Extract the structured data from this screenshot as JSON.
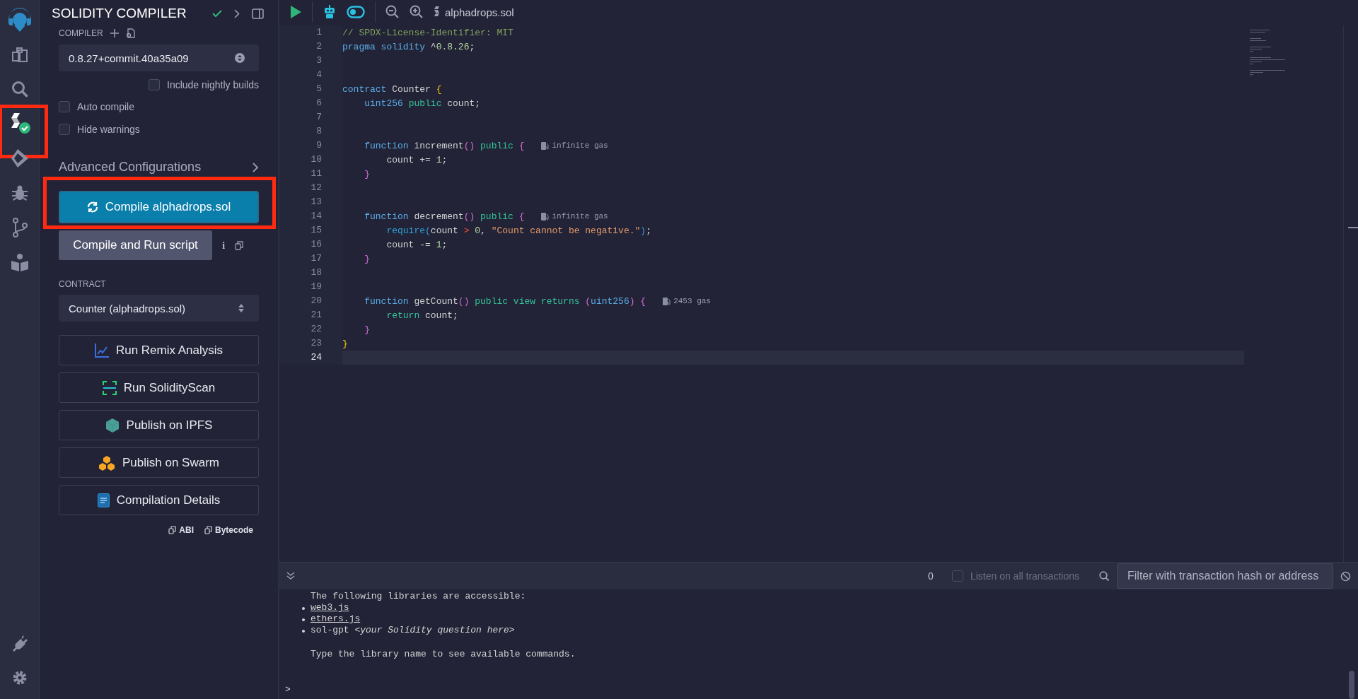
{
  "icon_bar": {
    "top": [
      {
        "kind": "logo",
        "highlighted": false
      },
      {
        "kind": "files",
        "highlighted": false
      },
      {
        "kind": "search",
        "highlighted": false
      },
      {
        "kind": "compiler",
        "highlighted": true
      },
      {
        "kind": "deploy",
        "highlighted": false
      },
      {
        "kind": "debugger",
        "highlighted": false
      },
      {
        "kind": "git",
        "highlighted": false
      },
      {
        "kind": "learn",
        "highlighted": false
      }
    ],
    "bottom": [
      {
        "kind": "plugins",
        "highlighted": false
      },
      {
        "kind": "settings",
        "highlighted": false
      }
    ]
  },
  "panel": {
    "title": "SOLIDITY COMPILER",
    "compiler_label": "COMPILER",
    "version": "0.8.27+commit.40a35a09",
    "nightly": {
      "label": "Include nightly builds",
      "checked": false
    },
    "options": [
      {
        "label": "Auto compile",
        "checked": false
      },
      {
        "label": "Hide warnings",
        "checked": false
      }
    ],
    "advanced": "Advanced Configurations",
    "compile_button": {
      "label": "Compile alphadrops.sol",
      "highlighted": true
    },
    "run_script": {
      "label": "Compile and Run script",
      "info": "i"
    },
    "contract_label": "CONTRACT",
    "contract": "Counter (alphadrops.sol)",
    "actions": [
      {
        "kind": "analysis",
        "label": "Run Remix Analysis"
      },
      {
        "kind": "scan",
        "label": "Run SolidityScan"
      },
      {
        "kind": "ipfs",
        "label": "Publish on IPFS"
      },
      {
        "kind": "swarm",
        "label": "Publish on Swarm"
      },
      {
        "kind": "details",
        "label": "Compilation Details"
      }
    ],
    "copy_links": [
      {
        "label": "ABI"
      },
      {
        "label": "Bytecode"
      }
    ]
  },
  "editor": {
    "file_tab": "alphadrops.sol",
    "lines": [
      {
        "number": "1",
        "current": false,
        "tokens": [
          {
            "kind": "comment",
            "s": "// SPDX-License-Identifier: MIT"
          }
        ]
      },
      {
        "number": "2",
        "current": false,
        "tokens": [
          {
            "kind": "keyword",
            "s": "pragma solidity"
          },
          {
            "kind": "plain",
            "s": " ^"
          },
          {
            "kind": "number",
            "s": "0.8.26"
          },
          {
            "kind": "plain",
            "s": ";"
          }
        ]
      },
      {
        "number": "3",
        "current": false
      },
      {
        "number": "4",
        "current": false
      },
      {
        "number": "5",
        "current": false,
        "tokens": [
          {
            "kind": "keyword",
            "s": "contract"
          },
          {
            "kind": "plain",
            "s": " Counter "
          },
          {
            "kind": "brace_outer",
            "s": "{"
          }
        ]
      },
      {
        "number": "6",
        "current": false,
        "tokens": [
          {
            "kind": "keyword",
            "s": "    uint256"
          },
          {
            "kind": "modifier",
            "s": " public"
          },
          {
            "kind": "plain",
            "s": " count;"
          }
        ]
      },
      {
        "number": "7",
        "current": false
      },
      {
        "number": "8",
        "current": false
      },
      {
        "number": "9",
        "current": false,
        "tokens": [
          {
            "kind": "keyword",
            "s": "    function"
          },
          {
            "kind": "plain",
            "s": " increment"
          },
          {
            "kind": "paren",
            "s": "()"
          },
          {
            "kind": "modifier",
            "s": " public"
          },
          {
            "kind": "paren",
            "s": " {"
          }
        ],
        "hint": "infinite gas"
      },
      {
        "number": "10",
        "current": false,
        "tokens": [
          {
            "kind": "plain",
            "s": "        count += "
          },
          {
            "kind": "number",
            "s": "1"
          },
          {
            "kind": "plain",
            "s": ";"
          }
        ]
      },
      {
        "number": "11",
        "current": false,
        "tokens": [
          {
            "kind": "paren",
            "s": "    }"
          }
        ]
      },
      {
        "number": "12",
        "current": false
      },
      {
        "number": "13",
        "current": false
      },
      {
        "number": "14",
        "current": false,
        "tokens": [
          {
            "kind": "keyword",
            "s": "    function"
          },
          {
            "kind": "plain",
            "s": " decrement"
          },
          {
            "kind": "paren",
            "s": "()"
          },
          {
            "kind": "modifier",
            "s": " public"
          },
          {
            "kind": "paren",
            "s": " {"
          }
        ],
        "hint": "infinite gas"
      },
      {
        "number": "15",
        "current": false,
        "tokens": [
          {
            "kind": "builtin",
            "s": "        require"
          },
          {
            "kind": "bracket",
            "s": "("
          },
          {
            "kind": "plain",
            "s": "count "
          },
          {
            "kind": "operator",
            "s": ">"
          },
          {
            "kind": "number",
            "s": " 0"
          },
          {
            "kind": "plain",
            "s": ", "
          },
          {
            "kind": "string",
            "s": "\"Count cannot be negative.\""
          },
          {
            "kind": "bracket",
            "s": ")"
          },
          {
            "kind": "plain",
            "s": ";"
          }
        ]
      },
      {
        "number": "16",
        "current": false,
        "tokens": [
          {
            "kind": "plain",
            "s": "        count -= "
          },
          {
            "kind": "number",
            "s": "1"
          },
          {
            "kind": "plain",
            "s": ";"
          }
        ]
      },
      {
        "number": "17",
        "current": false,
        "tokens": [
          {
            "kind": "paren",
            "s": "    }"
          }
        ]
      },
      {
        "number": "18",
        "current": false
      },
      {
        "number": "19",
        "current": false
      },
      {
        "number": "20",
        "current": false,
        "tokens": [
          {
            "kind": "keyword",
            "s": "    function"
          },
          {
            "kind": "plain",
            "s": " getCount"
          },
          {
            "kind": "paren",
            "s": "()"
          },
          {
            "kind": "modifier",
            "s": " public view returns"
          },
          {
            "kind": "paren",
            "s": " ("
          },
          {
            "kind": "keyword",
            "s": "uint256"
          },
          {
            "kind": "paren",
            "s": ")"
          },
          {
            "kind": "paren",
            "s": " {"
          }
        ],
        "hint": "2453 gas"
      },
      {
        "number": "21",
        "current": false,
        "tokens": [
          {
            "kind": "modifier",
            "s": "        return"
          },
          {
            "kind": "plain",
            "s": " count;"
          }
        ]
      },
      {
        "number": "22",
        "current": false,
        "tokens": [
          {
            "kind": "paren",
            "s": "    }"
          }
        ]
      },
      {
        "number": "23",
        "current": false,
        "tokens": [
          {
            "kind": "brace_outer",
            "s": "}"
          }
        ]
      },
      {
        "number": "24",
        "current": true
      }
    ]
  },
  "terminal": {
    "count": "0",
    "listen": {
      "label": "Listen on all transactions",
      "checked": false
    },
    "filter": {
      "placeholder": "Filter with transaction hash or address"
    },
    "intro": "The following libraries are accessible:",
    "libraries": [
      {
        "kind": "link",
        "text": "web3.js"
      },
      {
        "kind": "link",
        "text": "ethers.js"
      },
      {
        "kind": "plain",
        "text": "sol-gpt *<your Solidity question here>*"
      }
    ],
    "hint": "Type the library name to see available commands.",
    "prompt": ">"
  }
}
